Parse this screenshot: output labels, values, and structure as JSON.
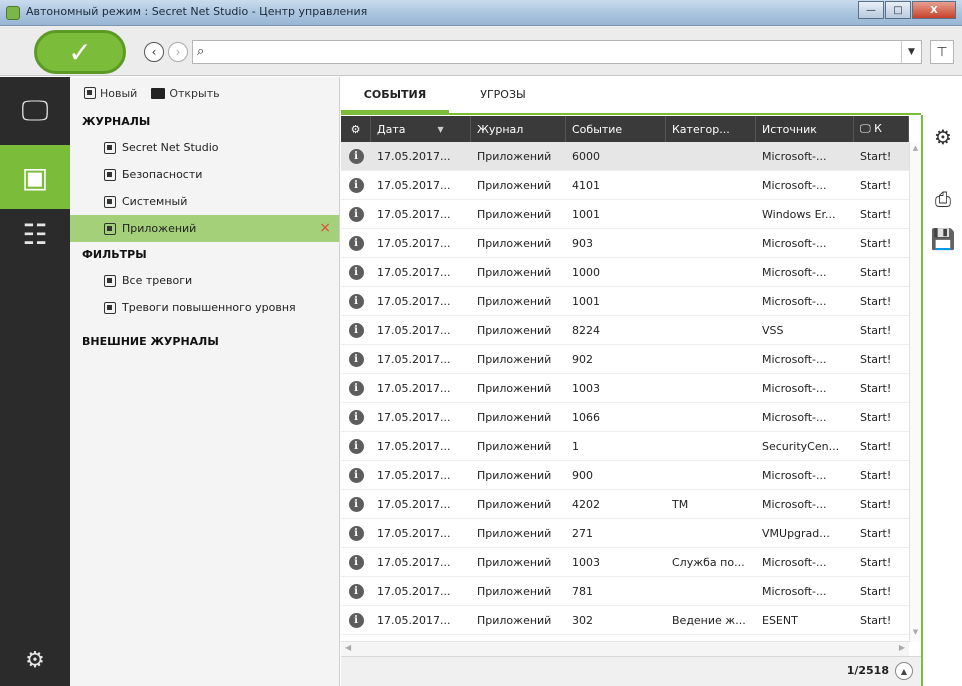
{
  "window": {
    "title": "Автономный режим : Secret Net Studio - Центр управления",
    "min_label": "—",
    "max_label": "□",
    "close_label": "X"
  },
  "toolbar": {
    "apply_label": "✓",
    "back_label": "‹",
    "forward_label": "›",
    "search_value": "",
    "search_placeholder": "",
    "search_icon": "⌕",
    "dropdown_icon": "▼",
    "filter_icon": "⊤"
  },
  "rail": {
    "items": [
      {
        "icon": "monitor-icon",
        "glyph": "🖵"
      },
      {
        "icon": "journal-icon",
        "glyph": "▣"
      },
      {
        "icon": "devices-icon",
        "glyph": "☷"
      },
      {
        "icon": "settings-icon",
        "glyph": "⚙"
      }
    ]
  },
  "tree": {
    "new_label": "Новый",
    "open_label": "Открыть",
    "journals_header": "ЖУРНАЛЫ",
    "journals": [
      {
        "label": "Secret Net Studio",
        "selected": false
      },
      {
        "label": "Безопасности",
        "selected": false
      },
      {
        "label": "Системный",
        "selected": false
      },
      {
        "label": "Приложений",
        "selected": true
      }
    ],
    "remove_label": "×",
    "filters_header": "ФИЛЬТРЫ",
    "filters": [
      {
        "label": "Все тревоги"
      },
      {
        "label": "Тревоги повышенного уровня"
      }
    ],
    "external_header": "ВНЕШНИЕ ЖУРНАЛЫ"
  },
  "tabs": [
    {
      "label": "СОБЫТИЯ",
      "active": true
    },
    {
      "label": "УГРОЗЫ",
      "active": false
    }
  ],
  "grid": {
    "columns": [
      "",
      "Дата",
      "Журнал",
      "Событие",
      "Категор...",
      "Источник",
      "🖵 К"
    ],
    "rows": [
      {
        "date": "17.05.2017...",
        "journal": "Приложений",
        "event": "6000",
        "category": "",
        "source": "Microsoft-...",
        "computer": "Start!"
      },
      {
        "date": "17.05.2017...",
        "journal": "Приложений",
        "event": "4101",
        "category": "",
        "source": "Microsoft-...",
        "computer": "Start!"
      },
      {
        "date": "17.05.2017...",
        "journal": "Приложений",
        "event": "1001",
        "category": "",
        "source": "Windows Er...",
        "computer": "Start!"
      },
      {
        "date": "17.05.2017...",
        "journal": "Приложений",
        "event": "903",
        "category": "",
        "source": "Microsoft-...",
        "computer": "Start!"
      },
      {
        "date": "17.05.2017...",
        "journal": "Приложений",
        "event": "1000",
        "category": "",
        "source": "Microsoft-...",
        "computer": "Start!"
      },
      {
        "date": "17.05.2017...",
        "journal": "Приложений",
        "event": "1001",
        "category": "",
        "source": "Microsoft-...",
        "computer": "Start!"
      },
      {
        "date": "17.05.2017...",
        "journal": "Приложений",
        "event": "8224",
        "category": "",
        "source": "VSS",
        "computer": "Start!"
      },
      {
        "date": "17.05.2017...",
        "journal": "Приложений",
        "event": "902",
        "category": "",
        "source": "Microsoft-...",
        "computer": "Start!"
      },
      {
        "date": "17.05.2017...",
        "journal": "Приложений",
        "event": "1003",
        "category": "",
        "source": "Microsoft-...",
        "computer": "Start!"
      },
      {
        "date": "17.05.2017...",
        "journal": "Приложений",
        "event": "1066",
        "category": "",
        "source": "Microsoft-...",
        "computer": "Start!"
      },
      {
        "date": "17.05.2017...",
        "journal": "Приложений",
        "event": "1",
        "category": "",
        "source": "SecurityCen...",
        "computer": "Start!"
      },
      {
        "date": "17.05.2017...",
        "journal": "Приложений",
        "event": "900",
        "category": "",
        "source": "Microsoft-...",
        "computer": "Start!"
      },
      {
        "date": "17.05.2017...",
        "journal": "Приложений",
        "event": "4202",
        "category": "TM",
        "source": "Microsoft-...",
        "computer": "Start!"
      },
      {
        "date": "17.05.2017...",
        "journal": "Приложений",
        "event": "271",
        "category": "",
        "source": "VMUpgrad...",
        "computer": "Start!"
      },
      {
        "date": "17.05.2017...",
        "journal": "Приложений",
        "event": "1003",
        "category": "Служба по...",
        "source": "Microsoft-...",
        "computer": "Start!"
      },
      {
        "date": "17.05.2017...",
        "journal": "Приложений",
        "event": "781",
        "category": "",
        "source": "Microsoft-...",
        "computer": "Start!"
      },
      {
        "date": "17.05.2017...",
        "journal": "Приложений",
        "event": "302",
        "category": "Ведение ж...",
        "source": "ESENT",
        "computer": "Start!"
      }
    ],
    "selected_row": 0
  },
  "status": {
    "pager": "1/2518",
    "up_label": "▲"
  },
  "right_tools": [
    {
      "icon": "settings-icon",
      "glyph": "⚙"
    },
    {
      "icon": "print-icon",
      "glyph": "⎙"
    },
    {
      "icon": "save-icon",
      "glyph": "💾"
    }
  ],
  "colors": {
    "accent": "#7bbd3a",
    "rail": "#2b2b2b",
    "header": "#3a3a3a"
  }
}
